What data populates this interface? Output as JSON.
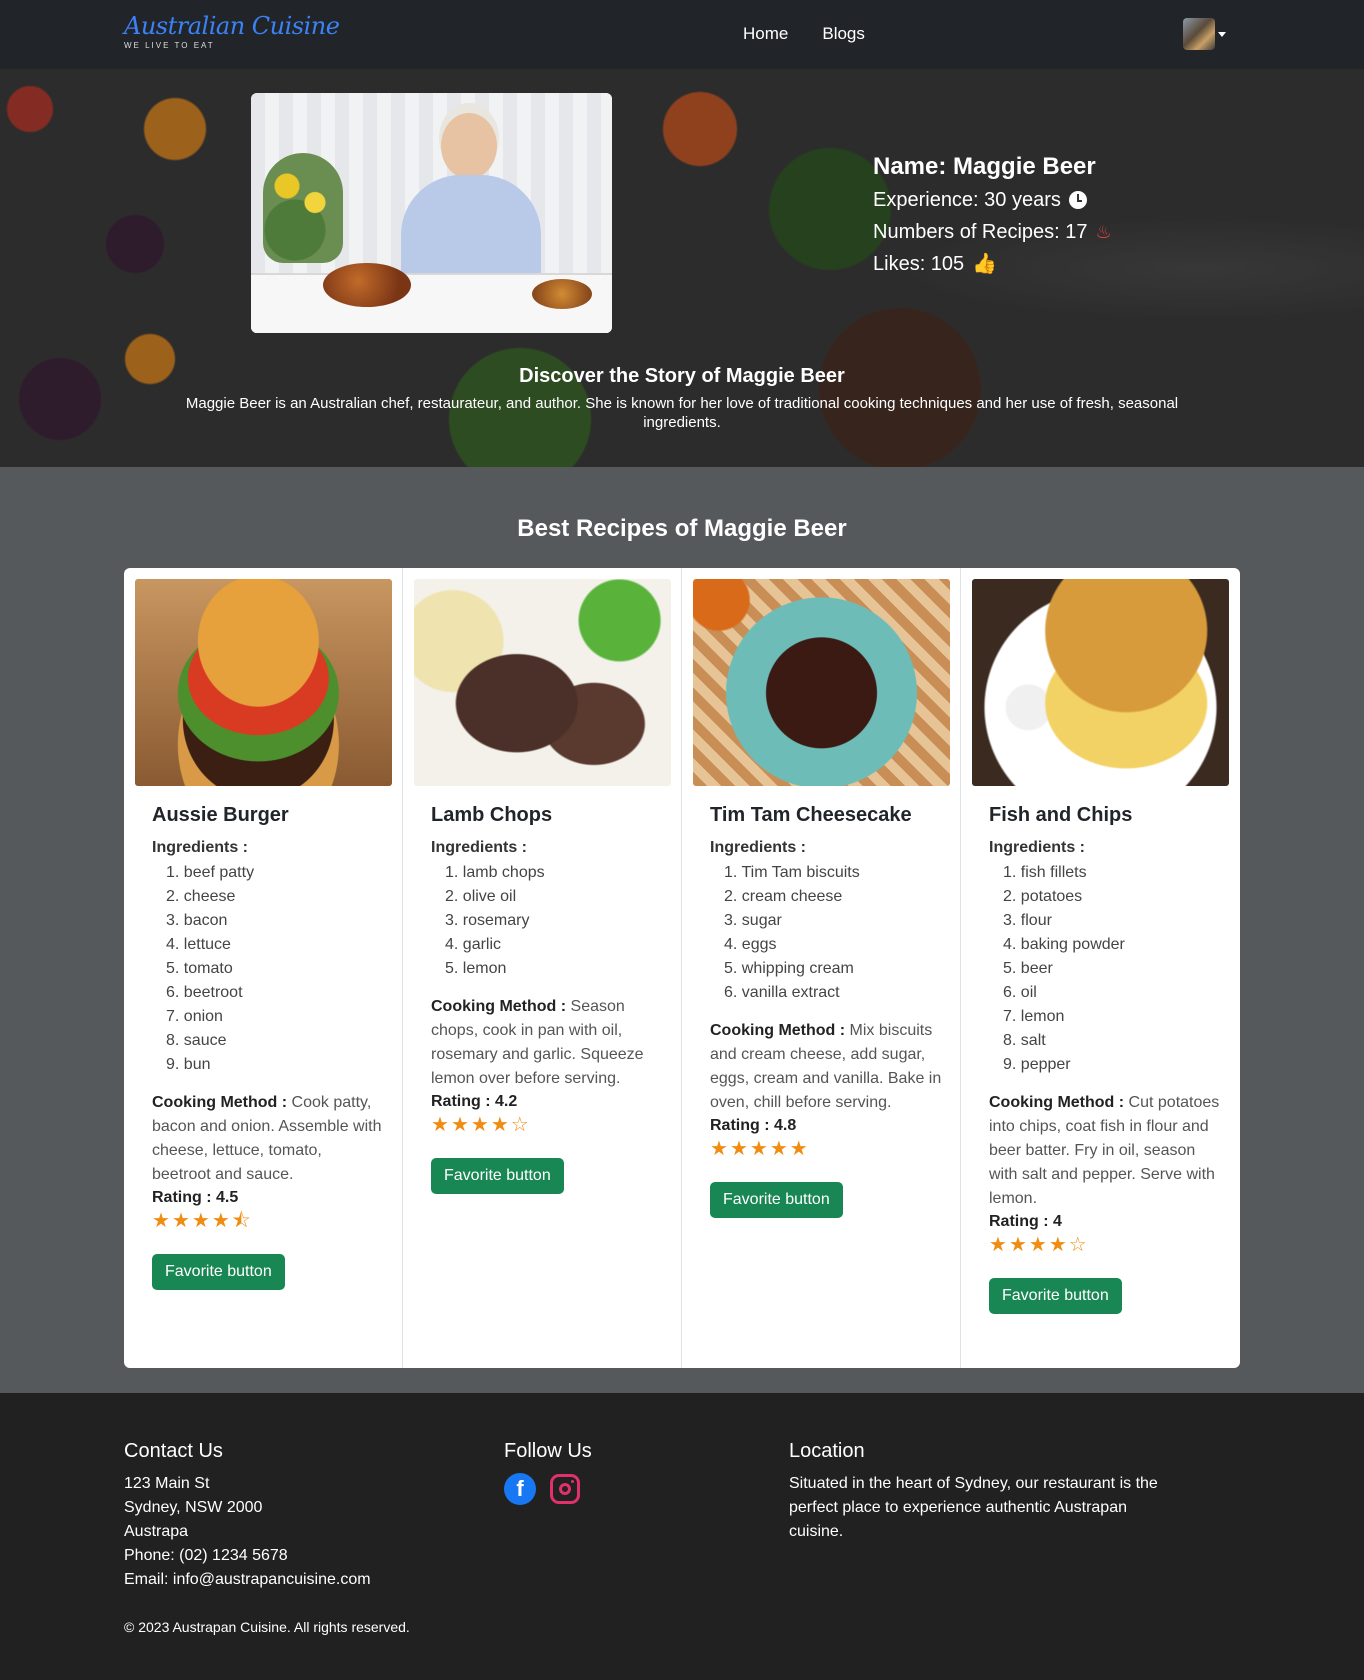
{
  "brand": {
    "name": "Australian Cuisine",
    "tagline": "WE LIVE TO EAT"
  },
  "nav": {
    "home": "Home",
    "blogs": "Blogs"
  },
  "chef": {
    "name_line": "Name: Maggie Beer",
    "experience_line": "Experience: 30 years",
    "recipes_line": "Numbers of Recipes: 17",
    "likes_line": "Likes: 105",
    "story_title": "Discover the Story of Maggie Beer",
    "story_text": "Maggie Beer is an Australian chef, restaurateur, and author. She is known for her love of traditional cooking techniques and her use of fresh, seasonal ingredients."
  },
  "recipes_title": "Best Recipes of Maggie Beer",
  "ingredients_label": "Ingredients :",
  "method_label": "Cooking Method :",
  "rating_label": "Rating :",
  "favorite_label": "Favorite button",
  "recipes": [
    {
      "title": "Aussie Burger",
      "ingredients": [
        "beef patty",
        "cheese",
        "bacon",
        "lettuce",
        "tomato",
        "beetroot",
        "onion",
        "sauce",
        "bun"
      ],
      "method": "Cook patty, bacon and onion. Assemble with cheese, lettuce, tomato, beetroot and sauce.",
      "rating": "4.5",
      "stars": 4.5
    },
    {
      "title": "Lamb Chops",
      "ingredients": [
        "lamb chops",
        "olive oil",
        "rosemary",
        "garlic",
        "lemon"
      ],
      "method": "Season chops, cook in pan with oil, rosemary and garlic. Squeeze lemon over before serving.",
      "rating": "4.2",
      "stars": 4
    },
    {
      "title": "Tim Tam Cheesecake",
      "ingredients": [
        "Tim Tam biscuits",
        "cream cheese",
        "sugar",
        "eggs",
        "whipping cream",
        "vanilla extract"
      ],
      "method": "Mix biscuits and cream cheese, add sugar, eggs, cream and vanilla. Bake in oven, chill before serving.",
      "rating": "4.8",
      "stars": 5
    },
    {
      "title": "Fish and Chips",
      "ingredients": [
        "fish fillets",
        "potatoes",
        "flour",
        "baking powder",
        "beer",
        "oil",
        "lemon",
        "salt",
        "pepper"
      ],
      "method": "Cut potatoes into chips, coat fish in flour and beer batter. Fry in oil, season with salt and pepper. Serve with lemon.",
      "rating": "4",
      "stars": 4
    }
  ],
  "footer": {
    "contact_title": "Contact Us",
    "address1": "123 Main St",
    "address2": "Sydney, NSW 2000",
    "address3": "Austrapa",
    "phone": "Phone: (02) 1234 5678",
    "email": "Email: info@austrapancuisine.com",
    "follow_title": "Follow Us",
    "location_title": "Location",
    "location_text": "Situated in the heart of Sydney, our restaurant is the perfect place to experience authentic Austrapan cuisine.",
    "copyright": "© 2023 Austrapan Cuisine. All rights reserved."
  },
  "colors": {
    "accent_green": "#198754",
    "star_orange": "#f08c12",
    "navbar": "#212529",
    "section_bg": "#55595c"
  }
}
